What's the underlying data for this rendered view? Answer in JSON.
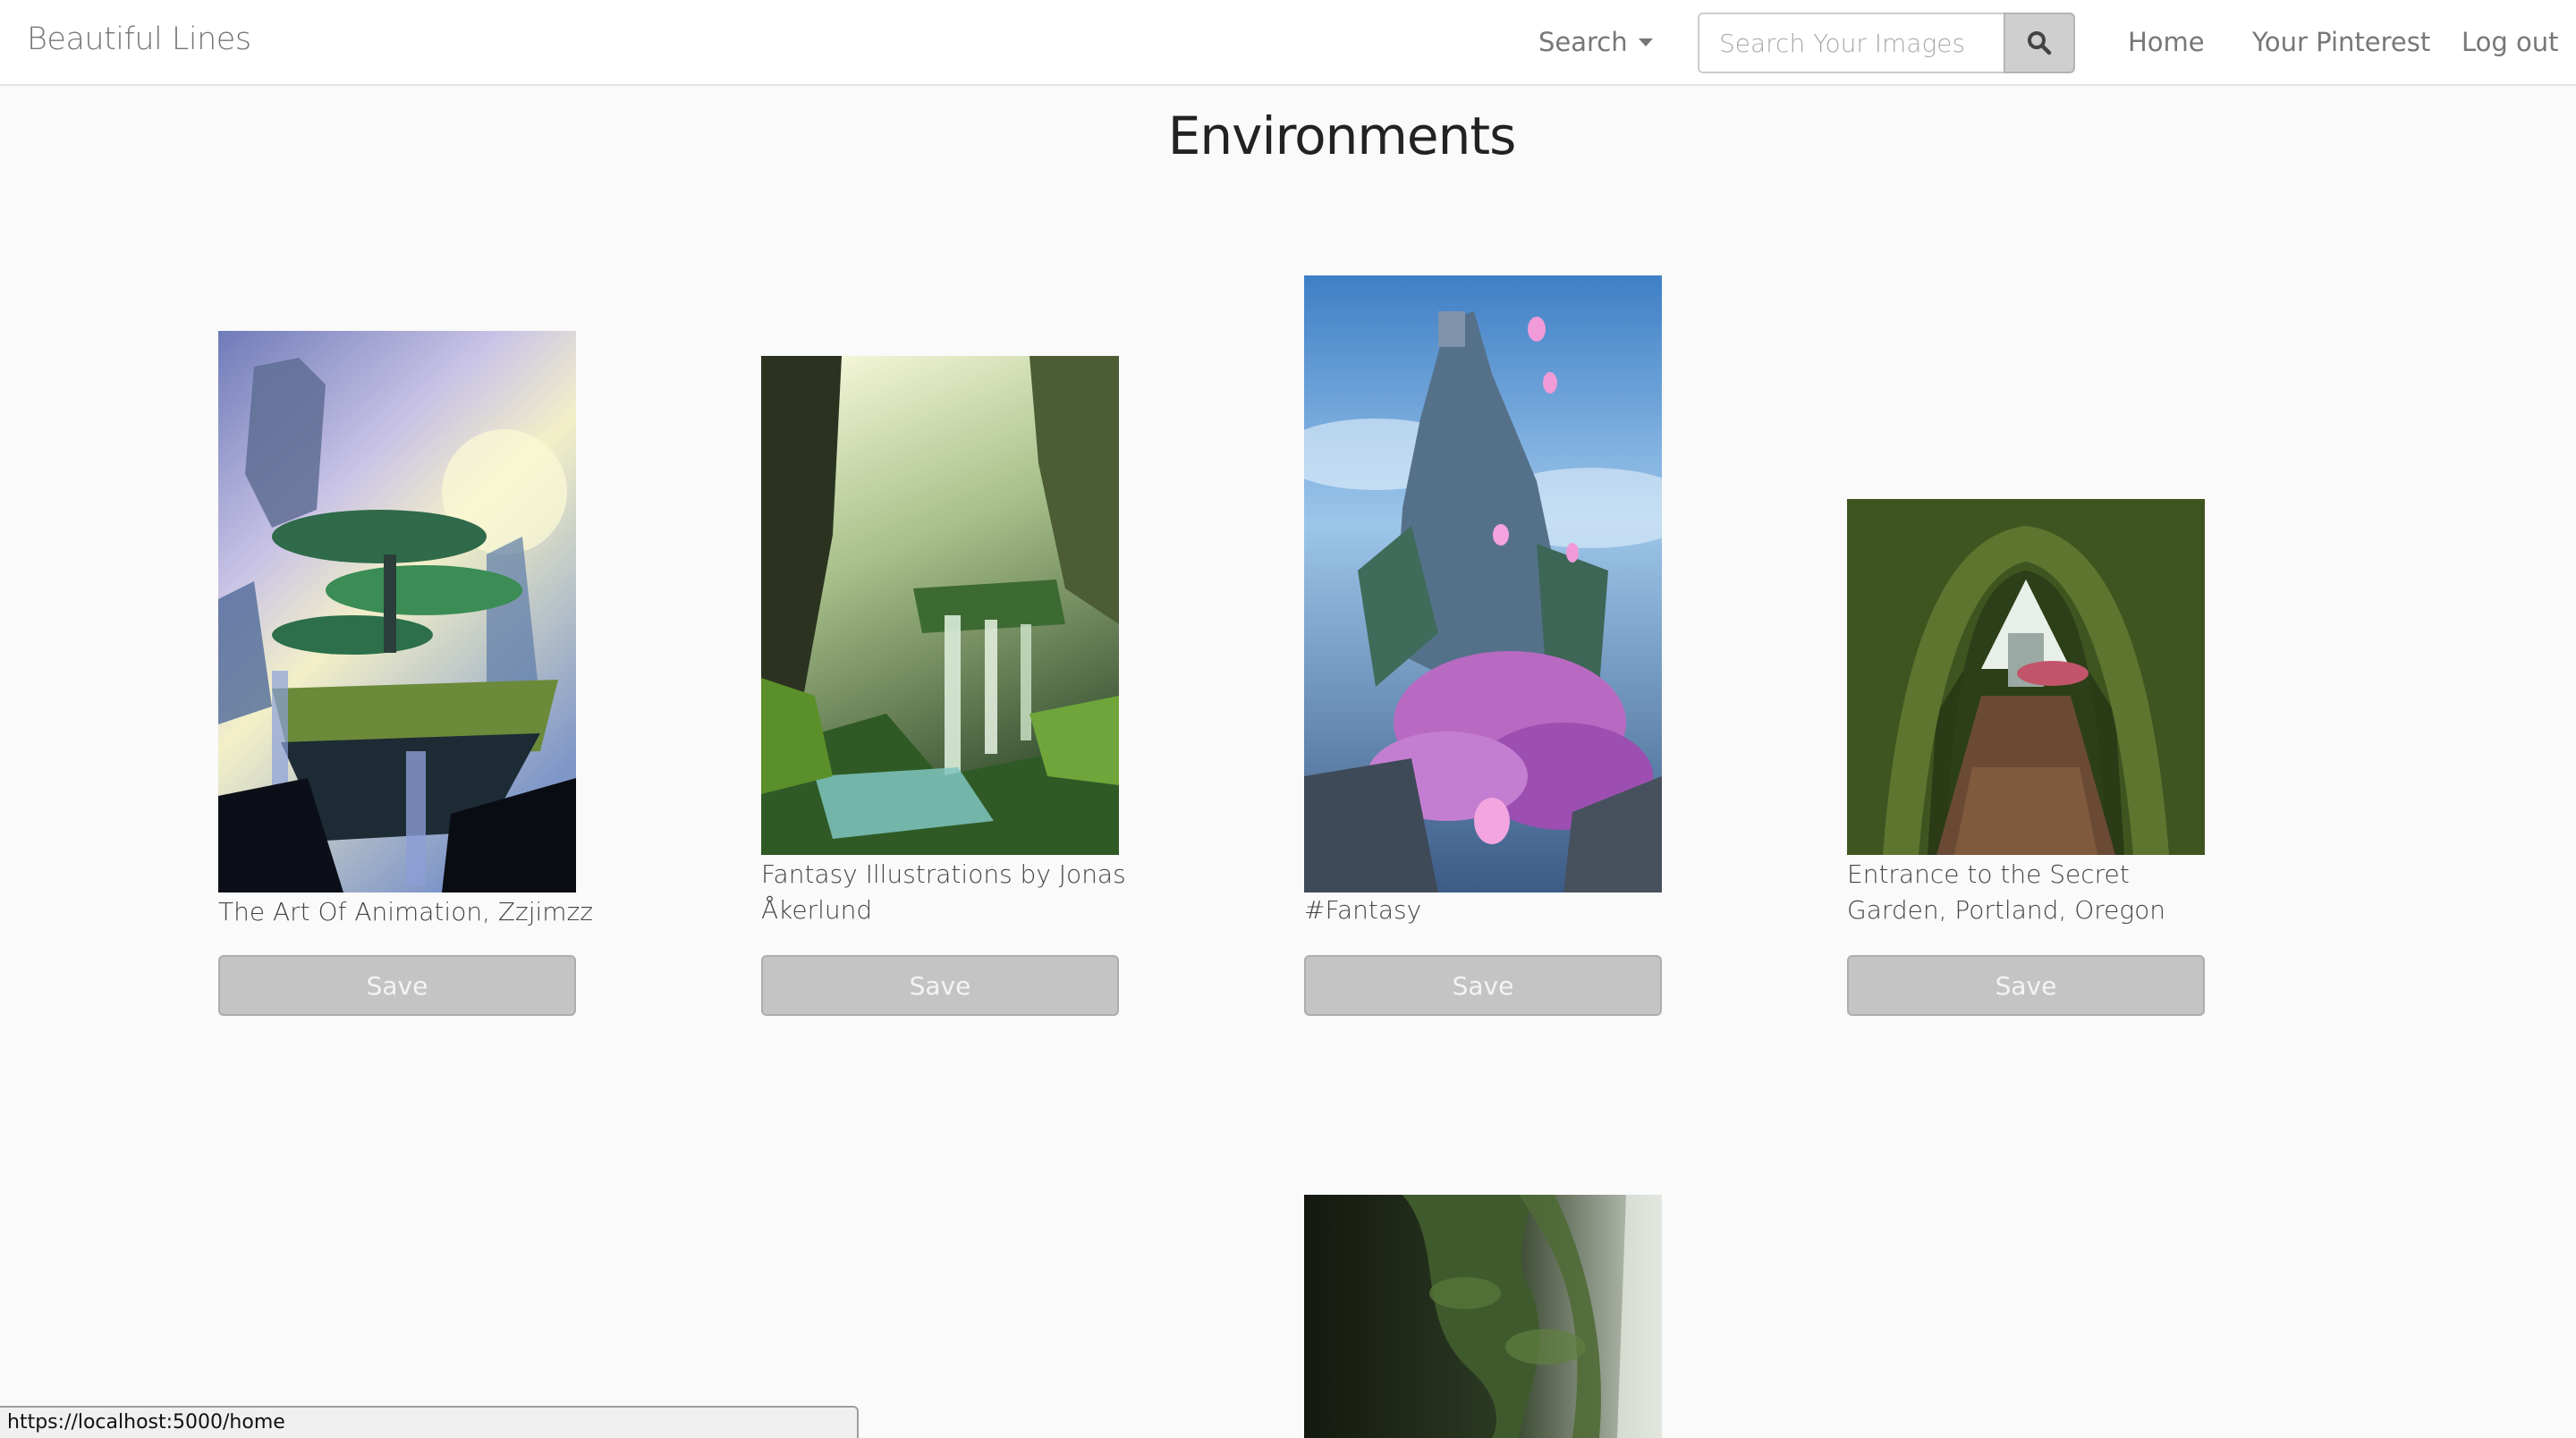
{
  "navbar": {
    "brand": "Beautiful Lines",
    "search_dropdown_label": "Search",
    "search_placeholder": "Search Your Images",
    "links": {
      "home": "Home",
      "your_pinterest": "Your Pinterest",
      "logout": "Log out"
    }
  },
  "page": {
    "title": "Environments"
  },
  "cards": [
    {
      "caption": "The Art Of Animation, Zzjimzz",
      "save_label": "Save"
    },
    {
      "caption": "Fantasy Illustrations by Jonas Åkerlund",
      "save_label": "Save"
    },
    {
      "caption": "#Fantasy",
      "save_label": "Save"
    },
    {
      "caption": "Entrance to the Secret Garden, Portland, Oregon",
      "save_label": "Save"
    }
  ],
  "status_bar": {
    "url": "https://localhost:5000/home"
  },
  "icons": {
    "search": "search-icon",
    "dropdown": "caret-down-icon"
  }
}
